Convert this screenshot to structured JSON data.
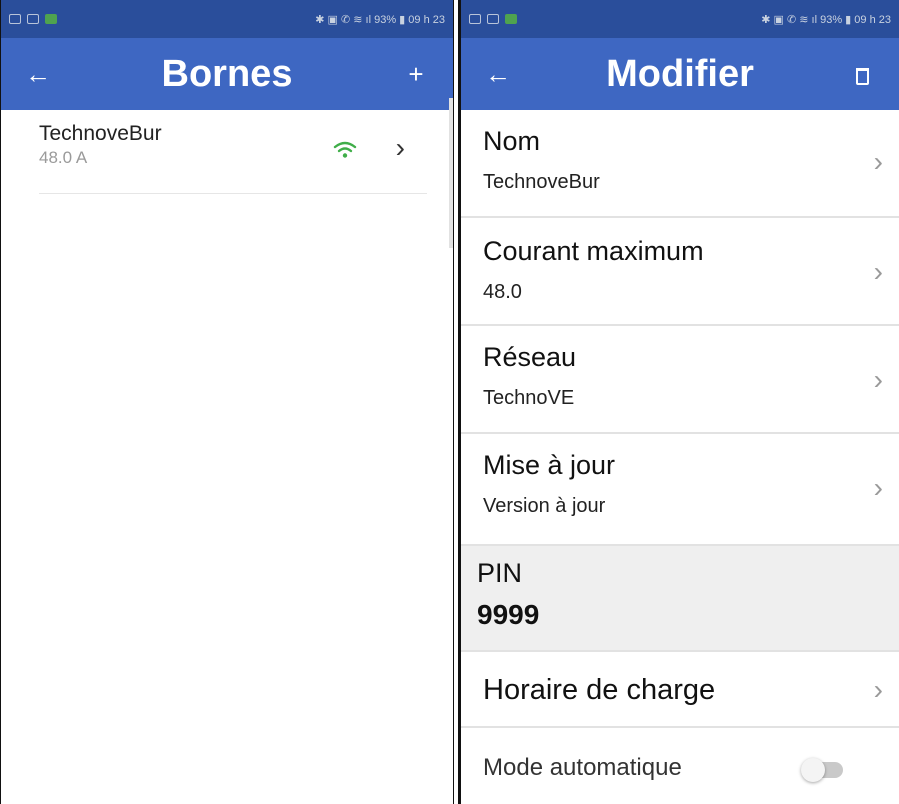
{
  "left": {
    "status": {
      "left_icons": [
        "signal-icon",
        "image-icon",
        "app-icon"
      ],
      "right_text": "✱ ▣ ✆ ≋ ıl 93% ▮ 09 h 23"
    },
    "header": {
      "back_icon": "←",
      "title": "Bornes",
      "add_icon": "+"
    },
    "items": [
      {
        "name": "TechnoveBur",
        "current": "48.0 A",
        "chevron": "›"
      }
    ]
  },
  "right": {
    "status": {
      "left_icons": [
        "image-icon",
        "signal-icon",
        "app-icon"
      ],
      "right_text": "✱ ▣ ✆ ≋ ıl 93% ▮ 09 h 23"
    },
    "header": {
      "back_icon": "←",
      "title": "Modifier"
    },
    "rows": {
      "nom": {
        "label": "Nom",
        "value": "TechnoveBur"
      },
      "courant": {
        "label": "Courant maximum",
        "value": "48.0"
      },
      "reseau": {
        "label": "Réseau",
        "value": "TechnoVE"
      },
      "maj": {
        "label": "Mise à jour",
        "value": "Version à jour"
      },
      "pin": {
        "label": "PIN",
        "value": "9999"
      },
      "horaire": {
        "label": "Horaire de charge"
      },
      "auto": {
        "label": "Mode automatique",
        "enabled": false
      }
    },
    "chevron": "›"
  },
  "colors": {
    "appbar": "#3e67c2",
    "statusbar": "#2a4e9b",
    "wifi": "#3fae49",
    "pin_bg": "#efefef"
  }
}
